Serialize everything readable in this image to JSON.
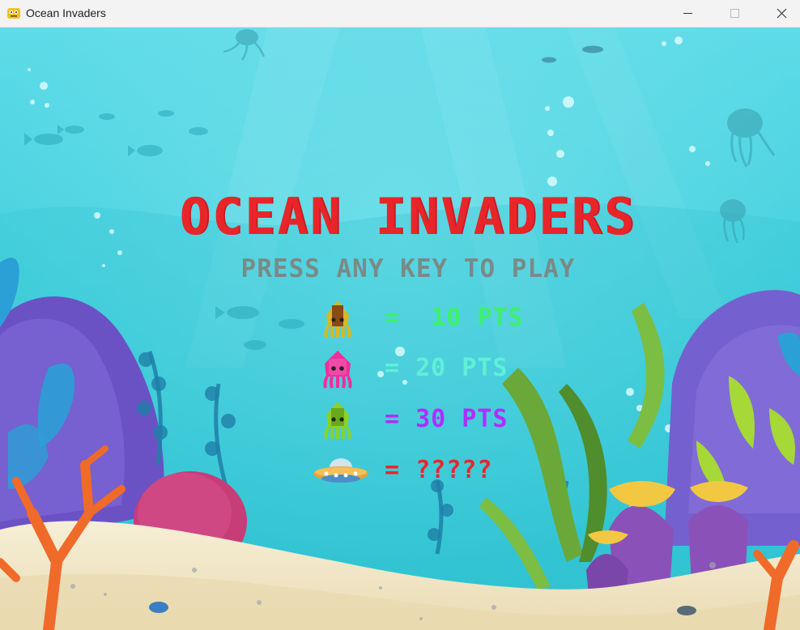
{
  "window": {
    "title": "Ocean Invaders",
    "icons": {
      "app": "pygame-snake-icon",
      "minimize": "minimize-icon",
      "maximize": "maximize-icon",
      "close": "close-icon"
    }
  },
  "game": {
    "title": "OCEAN INVADERS",
    "subtitle": "PRESS ANY KEY TO PLAY",
    "title_color": "#e8262a",
    "subtitle_color": "#7a8a86",
    "scores": [
      {
        "enemy": "yellow-squid",
        "label": "=  10 PTS",
        "color": "#3ef06a"
      },
      {
        "enemy": "pink-squid",
        "label": "= 20 PTS",
        "color": "#5ff0d8"
      },
      {
        "enemy": "green-squid",
        "label": "= 30 PTS",
        "color": "#b22cff"
      },
      {
        "enemy": "ufo",
        "label": "= ?????",
        "color": "#e8262a"
      }
    ]
  }
}
